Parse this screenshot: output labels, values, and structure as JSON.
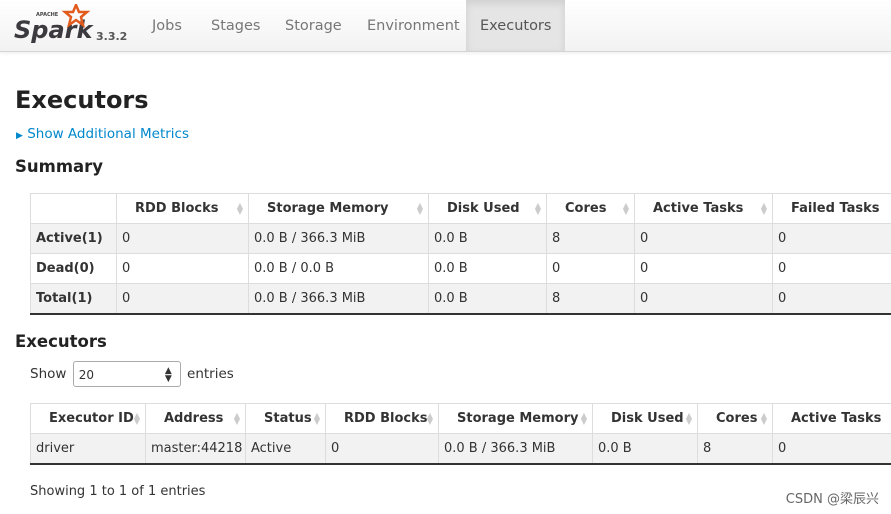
{
  "nav": {
    "logo_text": "Spark",
    "logo_sub": "APACHE",
    "version": "3.3.2",
    "tabs": [
      "Jobs",
      "Stages",
      "Storage",
      "Environment",
      "Executors"
    ],
    "active_tab": "Executors"
  },
  "page": {
    "title": "Executors",
    "additional_metrics": "Show Additional Metrics"
  },
  "summary": {
    "title": "Summary",
    "headers": [
      "",
      "RDD Blocks",
      "Storage Memory",
      "Disk Used",
      "Cores",
      "Active Tasks",
      "Failed Tasks"
    ],
    "rows": [
      [
        "Active(1)",
        "0",
        "0.0 B / 366.3 MiB",
        "0.0 B",
        "8",
        "0",
        "0"
      ],
      [
        "Dead(0)",
        "0",
        "0.0 B / 0.0 B",
        "0.0 B",
        "0",
        "0",
        "0"
      ],
      [
        "Total(1)",
        "0",
        "0.0 B / 366.3 MiB",
        "0.0 B",
        "8",
        "0",
        "0"
      ]
    ]
  },
  "executors": {
    "title": "Executors",
    "show_label": "Show",
    "entries_value": "20",
    "entries_label": "entries",
    "headers": [
      "Executor ID",
      "Address",
      "Status",
      "RDD Blocks",
      "Storage Memory",
      "Disk Used",
      "Cores",
      "Active Tasks"
    ],
    "rows": [
      [
        "driver",
        "master:44218",
        "Active",
        "0",
        "0.0 B / 366.3 MiB",
        "0.0 B",
        "8",
        "0"
      ]
    ],
    "info": "Showing 1 to 1 of 1 entries"
  },
  "watermark": "CSDN @梁辰兴",
  "colors": {
    "link": "#0088cc",
    "logo_star": "#e25a1c"
  }
}
